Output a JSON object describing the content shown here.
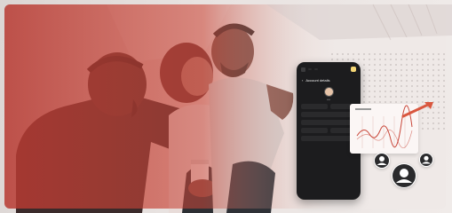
{
  "banner": {
    "alt": "Three friends cheering while watching a game, with a mobile account app overlay",
    "accent_color": "#d9573f",
    "tint_color": "#c9473a"
  },
  "phone": {
    "screen_title": "Account details",
    "tabs": [
      "",
      ""
    ],
    "caption": "••••"
  },
  "icons": [
    "user-avatar-icon",
    "growth-arrow-icon",
    "chart-icon"
  ]
}
